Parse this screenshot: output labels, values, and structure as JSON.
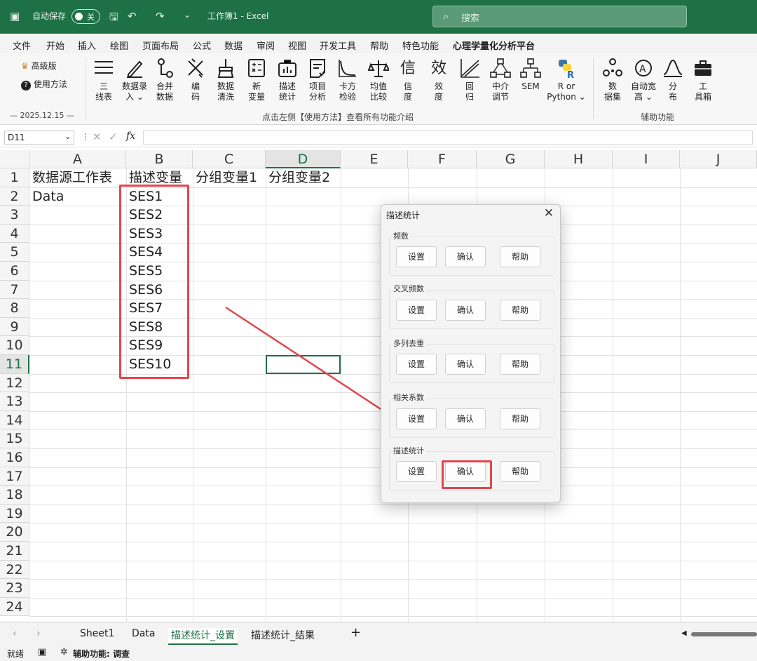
{
  "titlebar": {
    "autosave_label": "自动保存",
    "autosave_state": "关",
    "doc_title": "工作簿1 - Excel",
    "search_placeholder": "搜索"
  },
  "menu": [
    "文件",
    "开始",
    "插入",
    "绘图",
    "页面布局",
    "公式",
    "数据",
    "审阅",
    "视图",
    "开发工具",
    "帮助",
    "特色功能",
    "心理学量化分析平台"
  ],
  "ribbon": {
    "side": {
      "advanced": "高级版",
      "howto": "使用方法",
      "date": "— 2025.12.15 —"
    },
    "buttons": [
      {
        "label": "三\n线表",
        "icon": "three-line-table-icon"
      },
      {
        "label": "数据录\n入 ⌄",
        "icon": "pen-icon"
      },
      {
        "label": "合并\n数据",
        "icon": "merge-icon"
      },
      {
        "label": "编\n码",
        "icon": "code-icon"
      },
      {
        "label": "数据\n清洗",
        "icon": "broom-icon"
      },
      {
        "label": "新\n变量",
        "icon": "calculator-icon"
      },
      {
        "label": "描述\n统计",
        "icon": "bag-chart-icon"
      },
      {
        "label": "项目\n分析",
        "icon": "item-analysis-icon"
      },
      {
        "label": "卡方\n检验",
        "icon": "chi-curve-icon"
      },
      {
        "label": "均值\n比较",
        "icon": "balance-icon"
      },
      {
        "label": "信\n度",
        "icon": "xin-char-icon"
      },
      {
        "label": "效\n度",
        "icon": "xiao-char-icon"
      },
      {
        "label": "回\n归",
        "icon": "regression-icon"
      },
      {
        "label": "中介\n调节",
        "icon": "mediation-icon"
      },
      {
        "label": "SEM",
        "icon": "sem-icon"
      },
      {
        "label": "R or\nPython ⌄",
        "icon": "python-r-icon"
      },
      {
        "label": "数\n据集",
        "icon": "dataset-icon"
      },
      {
        "label": "自动宽\n高 ⌄",
        "icon": "autofit-icon"
      },
      {
        "label": "分\n布",
        "icon": "distribution-icon"
      },
      {
        "label": "工\n具箱",
        "icon": "toolbox-icon"
      }
    ],
    "group_main": "点击左侧【使用方法】查看所有功能介绍",
    "group_aux": "辅助功能"
  },
  "formula": {
    "namebox": "D11",
    "fx": "fx",
    "value": ""
  },
  "sheet": {
    "columns": [
      "A",
      "B",
      "C",
      "D",
      "E",
      "F",
      "G",
      "H",
      "I",
      "J"
    ],
    "rows": [
      "1",
      "2",
      "3",
      "4",
      "5",
      "6",
      "7",
      "8",
      "9",
      "10",
      "11",
      "12",
      "13",
      "14",
      "15",
      "16",
      "17",
      "18",
      "19",
      "20",
      "21",
      "22",
      "23",
      "24"
    ],
    "header_row": [
      "数据源工作表",
      "描述变量",
      "分组变量1",
      "分组变量2"
    ],
    "a2": "Data",
    "variables": [
      "SES1",
      "SES2",
      "SES3",
      "SES4",
      "SES5",
      "SES6",
      "SES7",
      "SES8",
      "SES9",
      "SES10"
    ]
  },
  "tabs": [
    "Sheet1",
    "Data",
    "描述统计_设置",
    "描述统计_结果"
  ],
  "status": {
    "ready": "就绪",
    "accessibility": "辅助功能: 调查"
  },
  "dialog": {
    "title": "描述统计",
    "groups": [
      {
        "label": "频数",
        "buttons": [
          "设置",
          "确认",
          "帮助"
        ]
      },
      {
        "label": "交叉频数",
        "buttons": [
          "设置",
          "确认",
          "帮助"
        ]
      },
      {
        "label": "多列去重",
        "buttons": [
          "设置",
          "确认",
          "帮助"
        ]
      },
      {
        "label": "相关系数",
        "buttons": [
          "设置",
          "确认",
          "帮助"
        ]
      },
      {
        "label": "描述统计",
        "buttons": [
          "设置",
          "确认",
          "帮助"
        ]
      }
    ]
  },
  "colors": {
    "excel_green": "#1e7145",
    "highlight_red": "#e2474f"
  }
}
